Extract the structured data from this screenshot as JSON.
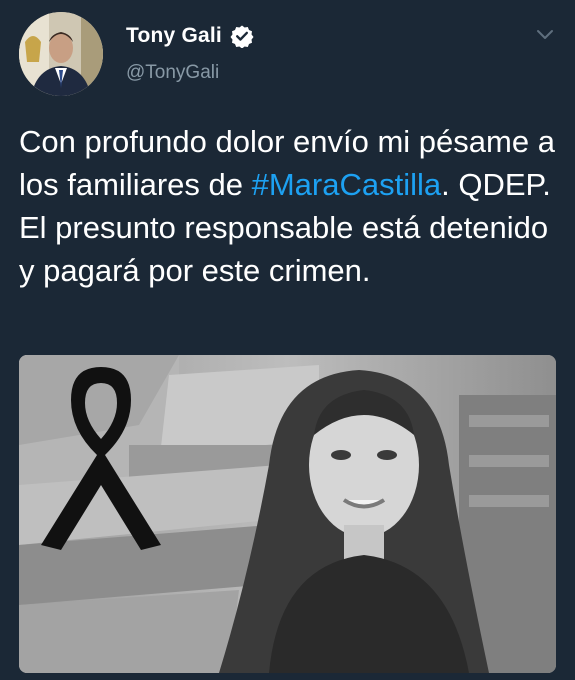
{
  "author": {
    "display_name": "Tony Gali",
    "handle": "@TonyGali",
    "verified": true
  },
  "tweet": {
    "text_before": "Con profundo dolor envío mi pésame a los familiares de ",
    "hashtag": "#MaraCastilla",
    "text_after": ". QDEP. El presunto responsable está detenido y pagará por este crimen."
  },
  "icons": {
    "verified": "verified-badge-icon",
    "menu": "chevron-down-icon",
    "ribbon": "black-mourning-ribbon-icon"
  },
  "colors": {
    "background": "#1b2836",
    "hashtag": "#1da1f2",
    "handle": "#8899a6"
  }
}
